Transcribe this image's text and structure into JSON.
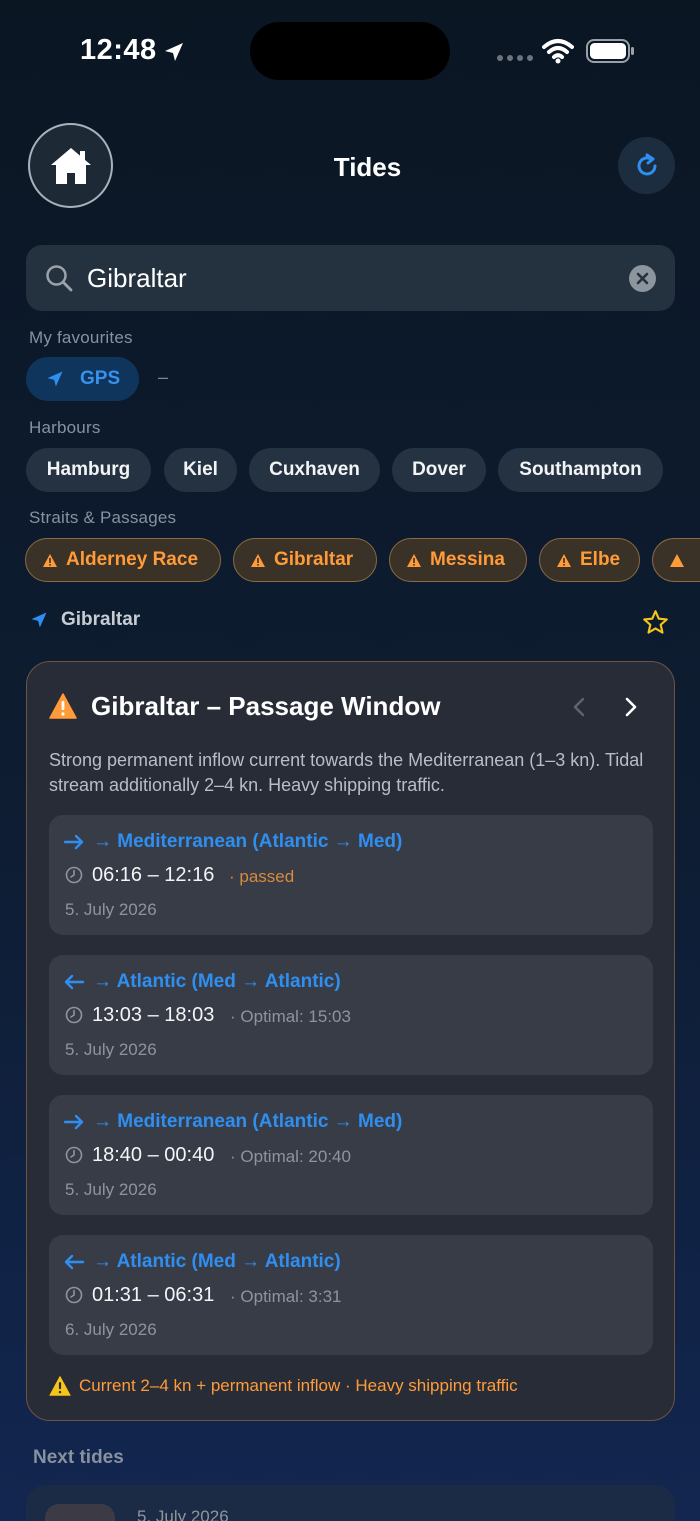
{
  "status_bar": {
    "time": "12:48"
  },
  "header": {
    "title": "Tides"
  },
  "search": {
    "value": "Gibraltar",
    "placeholder": ""
  },
  "favourites": {
    "label": "My favourites",
    "gps_label": "GPS",
    "empty": "–"
  },
  "harbours": {
    "label": "Harbours",
    "items": [
      "Hamburg",
      "Kiel",
      "Cuxhaven",
      "Dover",
      "Southampton"
    ]
  },
  "straits": {
    "label": "Straits & Passages",
    "items": [
      "Alderney Race",
      "Gibraltar",
      "Messina",
      "Elbe"
    ]
  },
  "location": {
    "name": "Gibraltar"
  },
  "passage": {
    "title": "Gibraltar – Passage Window",
    "description": "Strong permanent inflow current towards the Mediterranean (1–3 kn). Tidal stream additionally 2–4 kn. Heavy shipping traffic.",
    "windows": [
      {
        "direction": "→ Mediterranean (Atlantic → Med)",
        "time": "06:16 – 12:16",
        "note": "passed",
        "date": "5. July 2026"
      },
      {
        "direction": "→ Atlantic (Med → Atlantic)",
        "time": "13:03 – 18:03",
        "note": "Optimal: 15:03",
        "date": "5. July 2026"
      },
      {
        "direction": "→ Mediterranean (Atlantic → Med)",
        "time": "18:40 – 00:40",
        "note": "Optimal: 20:40",
        "date": "5. July 2026"
      },
      {
        "direction": "→ Atlantic (Med → Atlantic)",
        "time": "01:31 – 06:31",
        "note": "Optimal: 3:31",
        "date": "6. July 2026"
      }
    ],
    "footer": "Current 2–4 kn + permanent inflow · Heavy shipping traffic"
  },
  "next_tides": {
    "label": "Next tides",
    "first_date": "5. July 2026"
  },
  "colors": {
    "accent": "#2f8ff0",
    "warning": "#ff9b38",
    "star": "#f5c518"
  }
}
